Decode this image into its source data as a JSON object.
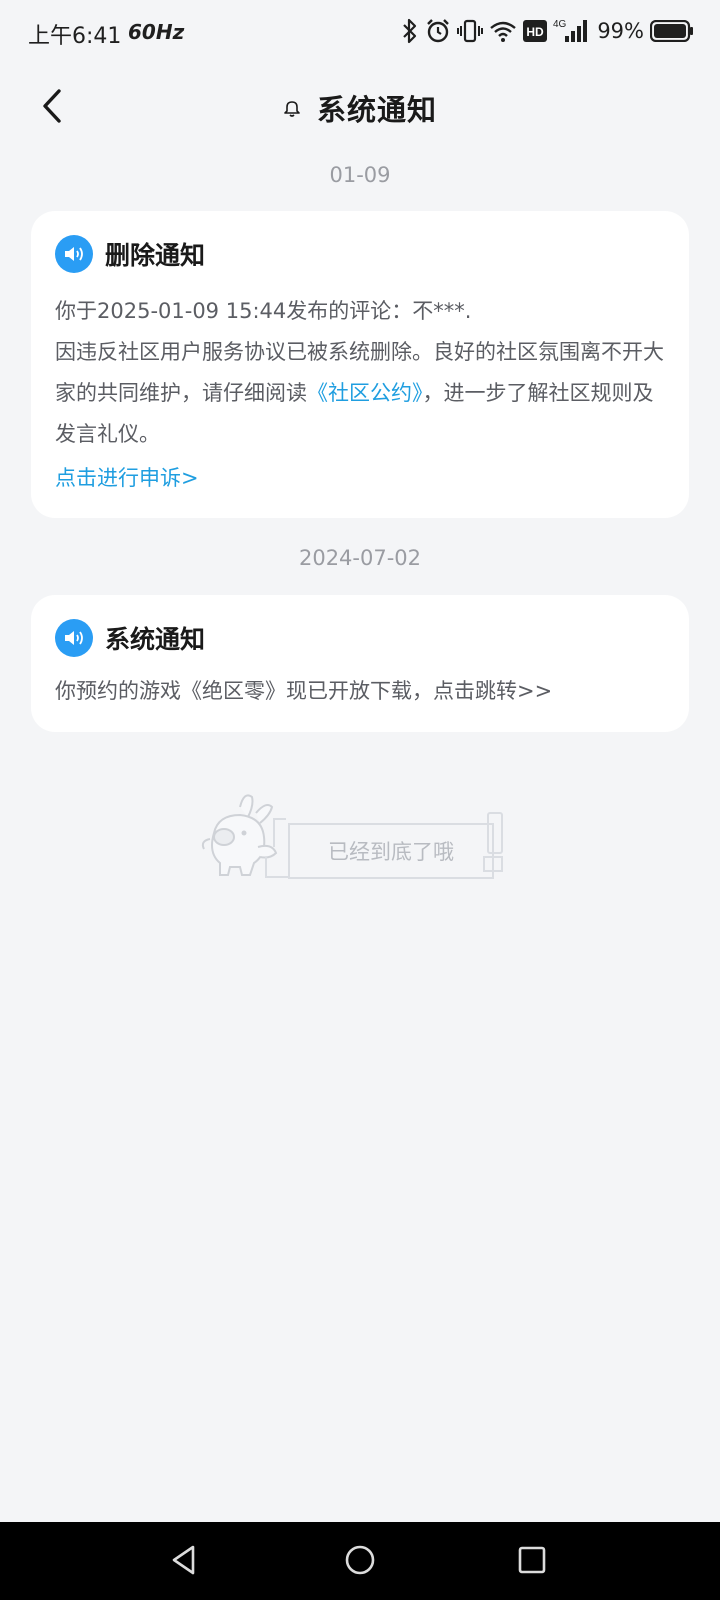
{
  "status_bar": {
    "time": "上午6:41",
    "refresh_rate": "60Hz",
    "battery_percent": "99%",
    "network": "4G",
    "hd_badge": "HD"
  },
  "header": {
    "title": "系统通知",
    "back_icon": "chevron-left-icon",
    "title_icon": "bell-icon"
  },
  "notifications": [
    {
      "date": "01-09",
      "title": "删除通知",
      "icon": "speaker-icon",
      "line1": "你于2025-01-09 15:44发布的评论：不***.",
      "body_before_link": "因违反社区用户服务协议已被系统删除。良好的社区氛围离不开大家的共同维护，请仔细阅读",
      "link_text": "《社区公约》",
      "body_after_link": "，进一步了解社区规则及发言礼仪。",
      "action_link": "点击进行申诉>"
    },
    {
      "date": "2024-07-02",
      "title": "系统通知",
      "icon": "speaker-icon",
      "body": "你预约的游戏《绝区零》现已开放下载，点击跳转>>"
    }
  ],
  "end_of_list": {
    "text": "已经到底了哦",
    "icon": "rabbit-mascot-icon"
  },
  "nav_bar": {
    "back_icon": "triangle-back-icon",
    "home_icon": "circle-home-icon",
    "recents_icon": "square-recents-icon"
  },
  "colors": {
    "background": "#f4f5f7",
    "accent_blue": "#2a9df4",
    "link_blue": "#1f9ee0",
    "muted_text": "#9a9ca2"
  }
}
